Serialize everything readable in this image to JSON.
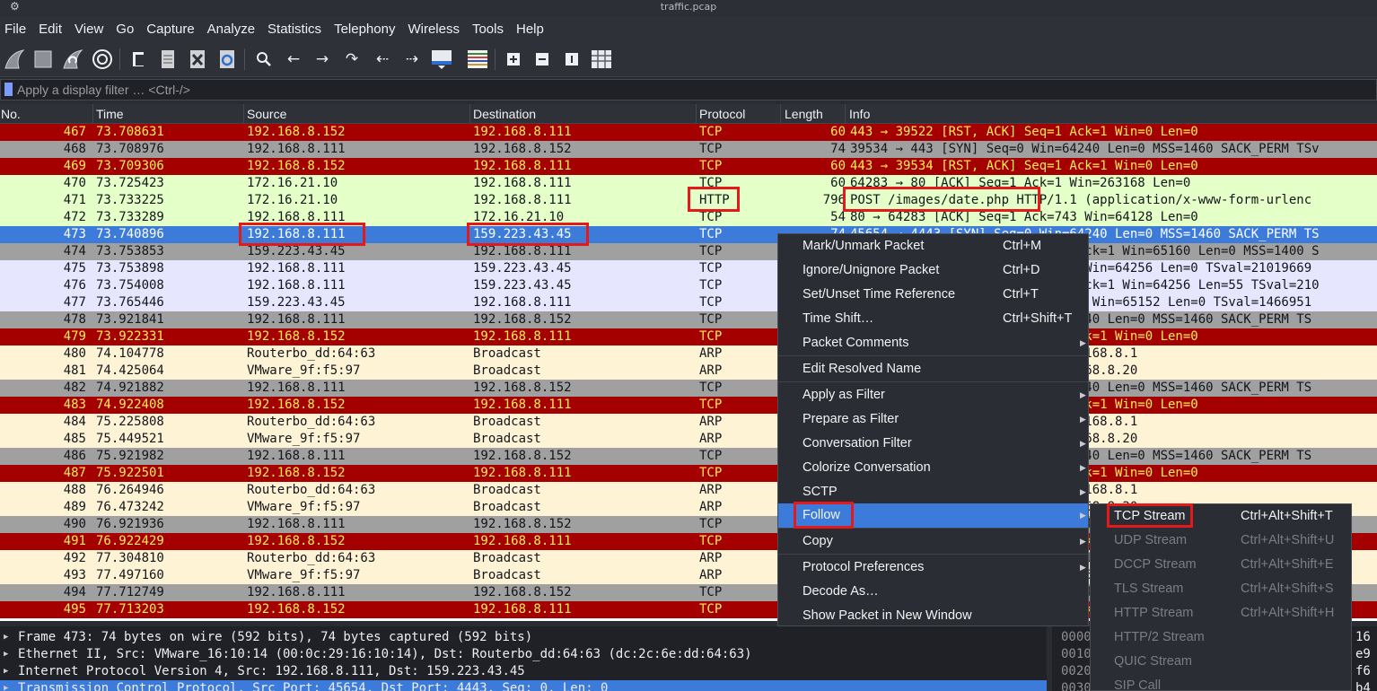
{
  "window": {
    "title": "traffic.pcap"
  },
  "menubar": [
    "File",
    "Edit",
    "View",
    "Go",
    "Capture",
    "Analyze",
    "Statistics",
    "Telephony",
    "Wireless",
    "Tools",
    "Help"
  ],
  "toolbar": {
    "icons": [
      "shark-fin-icon",
      "stop-icon",
      "restart-icon",
      "options-gear-icon",
      "open-file-icon",
      "save-file-icon",
      "close-file-icon",
      "reload-file-icon",
      "find-icon",
      "go-back-icon",
      "go-forward-icon",
      "go-to-packet-icon",
      "go-first-icon",
      "go-last-icon",
      "autoscroll-icon",
      "colorize-icon",
      "zoom-in-icon",
      "zoom-out-icon",
      "normal-size-icon",
      "resize-columns-icon"
    ]
  },
  "filter": {
    "placeholder": "Apply a display filter … <Ctrl-/>"
  },
  "columns": [
    "No.",
    "Time",
    "Source",
    "Destination",
    "Protocol",
    "Length",
    "Info"
  ],
  "colors": {
    "red_bg": "#a40000",
    "red_fg": "#ffee55",
    "gray_bg": "#a0a0a0",
    "gray_fg": "#13161a",
    "green_bg": "#e4ffc7",
    "lav_bg": "#e7e6ff",
    "cream_bg": "#fff3d6",
    "selected_bg": "#3d7bdb"
  },
  "packets": [
    {
      "no": "467",
      "time": "73.708631",
      "src": "192.168.8.152",
      "dst": "192.168.8.111",
      "proto": "TCP",
      "len": "60",
      "info": "443 → 39522 [RST, ACK] Seq=1 Ack=1 Win=0 Len=0",
      "style": "red"
    },
    {
      "no": "468",
      "time": "73.708976",
      "src": "192.168.8.111",
      "dst": "192.168.8.152",
      "proto": "TCP",
      "len": "74",
      "info": "39534 → 443 [SYN] Seq=0 Win=64240 Len=0 MSS=1460 SACK_PERM TSv",
      "style": "gray"
    },
    {
      "no": "469",
      "time": "73.709306",
      "src": "192.168.8.152",
      "dst": "192.168.8.111",
      "proto": "TCP",
      "len": "60",
      "info": "443 → 39534 [RST, ACK] Seq=1 Ack=1 Win=0 Len=0",
      "style": "red"
    },
    {
      "no": "470",
      "time": "73.725423",
      "src": "172.16.21.10",
      "dst": "192.168.8.111",
      "proto": "TCP",
      "len": "60",
      "info": "64283 → 80 [ACK] Seq=1 Ack=1 Win=263168 Len=0",
      "style": "green"
    },
    {
      "no": "471",
      "time": "73.733225",
      "src": "172.16.21.10",
      "dst": "192.168.8.111",
      "proto": "HTTP",
      "len": "796",
      "info": "POST /images/date.php HTTP/1.1  (application/x-www-form-urlenc",
      "style": "green"
    },
    {
      "no": "472",
      "time": "73.733289",
      "src": "192.168.8.111",
      "dst": "172.16.21.10",
      "proto": "TCP",
      "len": "54",
      "info": "80 → 64283 [ACK] Seq=1 Ack=743 Win=64128 Len=0",
      "style": "green"
    },
    {
      "no": "473",
      "time": "73.740896",
      "src": "192.168.8.111",
      "dst": "159.223.43.45",
      "proto": "TCP",
      "len": "74",
      "info": "45654 → 4443 [SYN] Seq=0 Win=64240 Len=0 MSS=1460 SACK_PERM TS",
      "style": "selected"
    },
    {
      "no": "474",
      "time": "73.753853",
      "src": "159.223.43.45",
      "dst": "192.168.8.111",
      "proto": "TCP",
      "len": "74",
      "info": "4443 → 45654 [SYN, ACK] Seq=0 Ack=1 Win=65160 Len=0 MSS=1400 S",
      "style": "gray"
    },
    {
      "no": "475",
      "time": "73.753898",
      "src": "192.168.8.111",
      "dst": "159.223.43.45",
      "proto": "TCP",
      "len": "66",
      "info": "45654 → 4443 [ACK] Seq=1 Ack=1 Win=64256 Len=0 TSval=21019669",
      "style": "lav"
    },
    {
      "no": "476",
      "time": "73.754008",
      "src": "192.168.8.111",
      "dst": "159.223.43.45",
      "proto": "TCP",
      "len": "121",
      "info": "45654 → 4443 [PSH, ACK] Seq=1 Ack=1 Win=64256 Len=55 TSval=210",
      "style": "lav"
    },
    {
      "no": "477",
      "time": "73.765446",
      "src": "159.223.43.45",
      "dst": "192.168.8.111",
      "proto": "TCP",
      "len": "66",
      "info": "4443 → 45654 [ACK] Seq=1 Ack=56 Win=65152 Len=0 TSval=1466951",
      "style": "lav"
    },
    {
      "no": "478",
      "time": "73.921841",
      "src": "192.168.8.111",
      "dst": "192.168.8.152",
      "proto": "TCP",
      "len": "74",
      "info": "39546 → 443 [SYN] Seq=0 Win=64240 Len=0 MSS=1460 SACK_PERM TS",
      "style": "gray"
    },
    {
      "no": "479",
      "time": "73.922331",
      "src": "192.168.8.152",
      "dst": "192.168.8.111",
      "proto": "TCP",
      "len": "60",
      "info": "443 → 39546 [RST, ACK] Seq=1 Ack=1 Win=0 Len=0",
      "style": "red"
    },
    {
      "no": "480",
      "time": "74.104778",
      "src": "Routerbo_dd:64:63",
      "dst": "Broadcast",
      "proto": "ARP",
      "len": "60",
      "info": "Who has 192.168.8.20? Tell 192.168.8.1",
      "style": "cream"
    },
    {
      "no": "481",
      "time": "74.425064",
      "src": "VMware_9f:f5:97",
      "dst": "Broadcast",
      "proto": "ARP",
      "len": "60",
      "info": "Who has 192.168.8.1? Tell 192.168.8.20",
      "style": "cream"
    },
    {
      "no": "482",
      "time": "74.921882",
      "src": "192.168.8.111",
      "dst": "192.168.8.152",
      "proto": "TCP",
      "len": "74",
      "info": "39548 → 443 [SYN] Seq=0 Win=64240 Len=0 MSS=1460 SACK_PERM TS",
      "style": "gray"
    },
    {
      "no": "483",
      "time": "74.922408",
      "src": "192.168.8.152",
      "dst": "192.168.8.111",
      "proto": "TCP",
      "len": "60",
      "info": "443 → 39548 [RST, ACK] Seq=1 Ack=1 Win=0 Len=0",
      "style": "red"
    },
    {
      "no": "484",
      "time": "75.225808",
      "src": "Routerbo_dd:64:63",
      "dst": "Broadcast",
      "proto": "ARP",
      "len": "60",
      "info": "Who has 192.168.8.20? Tell 192.168.8.1",
      "style": "cream"
    },
    {
      "no": "485",
      "time": "75.449521",
      "src": "VMware_9f:f5:97",
      "dst": "Broadcast",
      "proto": "ARP",
      "len": "60",
      "info": "Who has 192.168.8.1? Tell 192.168.8.20",
      "style": "cream"
    },
    {
      "no": "486",
      "time": "75.921982",
      "src": "192.168.8.111",
      "dst": "192.168.8.152",
      "proto": "TCP",
      "len": "74",
      "info": "39550 → 443 [SYN] Seq=0 Win=64240 Len=0 MSS=1460 SACK_PERM TS",
      "style": "gray"
    },
    {
      "no": "487",
      "time": "75.922501",
      "src": "192.168.8.152",
      "dst": "192.168.8.111",
      "proto": "TCP",
      "len": "60",
      "info": "443 → 39550 [RST, ACK] Seq=1 Ack=1 Win=0 Len=0",
      "style": "red"
    },
    {
      "no": "488",
      "time": "76.264946",
      "src": "Routerbo_dd:64:63",
      "dst": "Broadcast",
      "proto": "ARP",
      "len": "60",
      "info": "Who has 192.168.8.20? Tell 192.168.8.1",
      "style": "cream"
    },
    {
      "no": "489",
      "time": "76.473242",
      "src": "VMware_9f:f5:97",
      "dst": "Broadcast",
      "proto": "ARP",
      "len": "60",
      "info": "Who has 192.168.8.1? Tell 192.168.8.20",
      "style": "cream"
    },
    {
      "no": "490",
      "time": "76.921936",
      "src": "192.168.8.111",
      "dst": "192.168.8.152",
      "proto": "TCP",
      "len": "74",
      "info": "39552 → 443 [SYN] Seq=0 Win=64240 Len=0 MSS=1460 SACK_PERM TS",
      "style": "gray"
    },
    {
      "no": "491",
      "time": "76.922429",
      "src": "192.168.8.152",
      "dst": "192.168.8.111",
      "proto": "TCP",
      "len": "60",
      "info": "443 → 39552 [RST, ACK] Seq=1 Ack=1 Win=0 Len=0",
      "style": "red"
    },
    {
      "no": "492",
      "time": "77.304810",
      "src": "Routerbo_dd:64:63",
      "dst": "Broadcast",
      "proto": "ARP",
      "len": "60",
      "info": "Who has 192.168.8.20? Tell 192.168.8.1",
      "style": "cream"
    },
    {
      "no": "493",
      "time": "77.497160",
      "src": "VMware_9f:f5:97",
      "dst": "Broadcast",
      "proto": "ARP",
      "len": "60",
      "info": "Who has 192.168.8.1? Tell 192.168.8.20",
      "style": "cream"
    },
    {
      "no": "494",
      "time": "77.712749",
      "src": "192.168.8.111",
      "dst": "192.168.8.152",
      "proto": "TCP",
      "len": "74",
      "info": "39554 → 443 [SYN] Seq=0 Win=64240 Len=0 MSS=1460 SACK_PERM TS",
      "style": "gray"
    },
    {
      "no": "495",
      "time": "77.713203",
      "src": "192.168.8.152",
      "dst": "192.168.8.111",
      "proto": "TCP",
      "len": "60",
      "info": "443 → 39554 [RST, ACK] Seq=1 Ack=1 Win=0 Len=0",
      "style": "red"
    }
  ],
  "details": [
    "Frame 473: 74 bytes on wire (592 bits), 74 bytes captured (592 bits)",
    "Ethernet II, Src: VMware_16:10:14 (00:0c:29:16:10:14), Dst: Routerbo_dd:64:63 (dc:2c:6e:dd:64:63)",
    "Internet Protocol Version 4, Src: 192.168.8.111, Dst: 159.223.43.45",
    "Transmission Control Protocol, Src Port: 45654, Dst Port: 4443, Seq: 0, Len: 0"
  ],
  "hex": {
    "offsets": [
      "0000",
      "0010",
      "0020",
      "0030"
    ],
    "right": [
      "16",
      "e9",
      "f6",
      "b4"
    ]
  },
  "context_menu": [
    {
      "label": "Mark/Unmark Packet",
      "shortcut": "Ctrl+M"
    },
    {
      "label": "Ignore/Unignore Packet",
      "shortcut": "Ctrl+D"
    },
    {
      "label": "Set/Unset Time Reference",
      "shortcut": "Ctrl+T"
    },
    {
      "label": "Time Shift…",
      "shortcut": "Ctrl+Shift+T"
    },
    {
      "label": "Packet Comments",
      "shortcut": "",
      "submenu": true
    },
    {
      "label": "Edit Resolved Name",
      "shortcut": ""
    },
    {
      "label": "Apply as Filter",
      "shortcut": "",
      "submenu": true
    },
    {
      "label": "Prepare as Filter",
      "shortcut": "",
      "submenu": true
    },
    {
      "label": "Conversation Filter",
      "shortcut": "",
      "submenu": true
    },
    {
      "label": "Colorize Conversation",
      "shortcut": "",
      "submenu": true
    },
    {
      "label": "SCTP",
      "shortcut": "",
      "submenu": true
    },
    {
      "label": "Follow",
      "shortcut": "",
      "submenu": true,
      "active": true
    },
    {
      "label": "Copy",
      "shortcut": "",
      "submenu": true
    },
    {
      "label": "Protocol Preferences",
      "shortcut": "",
      "submenu": true
    },
    {
      "label": "Decode As…",
      "shortcut": ""
    },
    {
      "label": "Show Packet in New Window",
      "shortcut": ""
    }
  ],
  "follow_submenu": [
    {
      "label": "TCP Stream",
      "shortcut": "Ctrl+Alt+Shift+T",
      "enabled": true
    },
    {
      "label": "UDP Stream",
      "shortcut": "Ctrl+Alt+Shift+U",
      "enabled": false
    },
    {
      "label": "DCCP Stream",
      "shortcut": "Ctrl+Alt+Shift+E",
      "enabled": false
    },
    {
      "label": "TLS Stream",
      "shortcut": "Ctrl+Alt+Shift+S",
      "enabled": false
    },
    {
      "label": "HTTP Stream",
      "shortcut": "Ctrl+Alt+Shift+H",
      "enabled": false
    },
    {
      "label": "HTTP/2 Stream",
      "shortcut": "",
      "enabled": false
    },
    {
      "label": "QUIC Stream",
      "shortcut": "",
      "enabled": false
    },
    {
      "label": "SIP Call",
      "shortcut": "",
      "enabled": false
    }
  ]
}
